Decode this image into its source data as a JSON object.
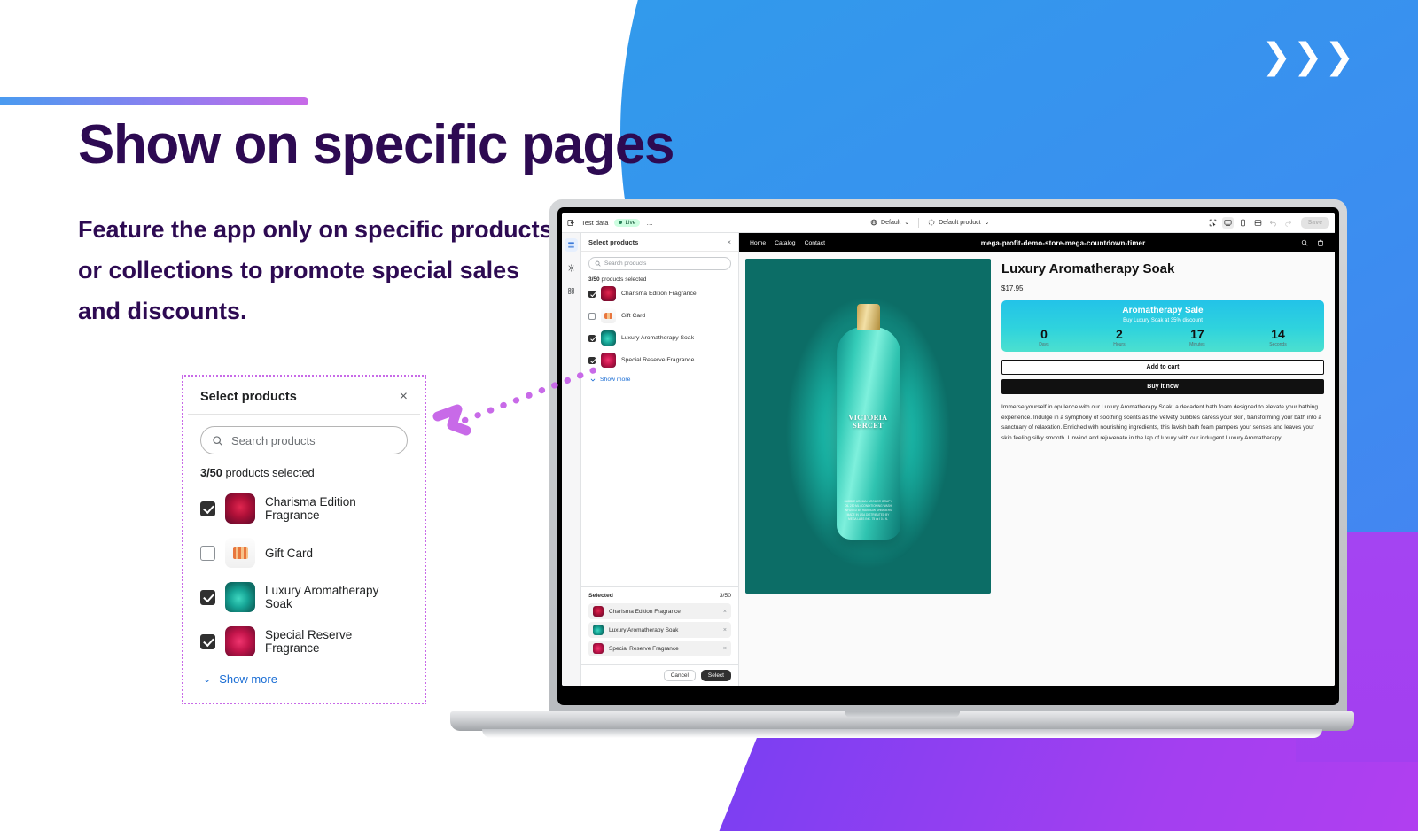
{
  "hero": {
    "headline": "Show on specific pages",
    "subhead": "Feature the app only on specific products or collections to promote special sales and discounts.",
    "chevron_glyph": "❯"
  },
  "colors": {
    "heading": "#2d0a52",
    "blue": "#3b8ef0",
    "purple": "#a33ff0",
    "callout_border": "#c86ae8",
    "link": "#1a6dd4",
    "timer_start": "#23c3e8",
    "timer_end": "#4ce0cf"
  },
  "callout": {
    "title": "Select products",
    "close_label": "×",
    "search_placeholder": "Search products",
    "search_icon": "search-icon",
    "count_bold": "3/50",
    "count_rest": " products selected",
    "show_more": "Show more",
    "chevron": "⌄",
    "products": [
      {
        "name": "Charisma Edition Fragrance",
        "checked": true,
        "thumb": "t-charisma"
      },
      {
        "name": "Gift Card",
        "checked": false,
        "thumb": "t-gift"
      },
      {
        "name": "Luxury Aromatherapy Soak",
        "checked": true,
        "thumb": "t-luxury"
      },
      {
        "name": "Special Reserve Fragrance",
        "checked": true,
        "thumb": "t-special"
      }
    ]
  },
  "admin": {
    "topbar": {
      "exit_icon": "exit-icon",
      "store_name": "Test data",
      "status": "Live",
      "more": "…",
      "theme_select": "Default",
      "template_select": "Default product",
      "theme_icon": "globe-icon",
      "template_icon": "page-icon",
      "chevron": "⌄",
      "view_icons": [
        "inspector-icon",
        "desktop-icon",
        "mobile-icon",
        "fullscreen-icon"
      ],
      "undo_icon": "undo-icon",
      "redo_icon": "redo-icon",
      "save_label": "Save"
    },
    "rail": [
      "sections-icon",
      "settings-icon",
      "apps-icon"
    ],
    "panel": {
      "title": "Select products",
      "close_label": "×",
      "search_placeholder": "Search products",
      "count_bold": "3/50",
      "count_rest": " products selected",
      "show_more": "Show more",
      "products": [
        {
          "name": "Charisma Edition Fragrance",
          "checked": true,
          "thumb": "t-charisma"
        },
        {
          "name": "Gift Card",
          "checked": false,
          "thumb": "t-gift"
        },
        {
          "name": "Luxury Aromatherapy Soak",
          "checked": true,
          "thumb": "t-luxury"
        },
        {
          "name": "Special Reserve Fragrance",
          "checked": true,
          "thumb": "t-special"
        }
      ],
      "selected_label": "Selected",
      "selected_count": "3/50",
      "selected_items": [
        {
          "name": "Charisma Edition Fragrance",
          "thumb": "t-charisma",
          "remove": "×"
        },
        {
          "name": "Luxury Aromatherapy Soak",
          "thumb": "t-luxury",
          "remove": "×"
        },
        {
          "name": "Special Reserve Fragrance",
          "thumb": "t-special",
          "remove": "×"
        }
      ],
      "cancel_label": "Cancel",
      "select_label": "Select"
    }
  },
  "store": {
    "nav_links": [
      "Home",
      "Catalog",
      "Contact"
    ],
    "brand": "mega-profit-demo-store-mega-countdown-timer",
    "search_icon": "search-icon",
    "cart_icon": "cart-icon",
    "bottle_brand": "VICTORIA SERCET",
    "bottle_fineprint": "BUBBLE AROMA / AROMATHERAPY OIL 250 ML / CONDITIONING WASH INFUSED BY RAINBOW SHIMMERS MADE IN USA DISTRIBUTED BY MEGA LABS INC.  75 oz l 0.4 fL",
    "product": {
      "title": "Luxury Aromatherapy Soak",
      "price": "$17.95",
      "add_to_cart": "Add to cart",
      "buy_now": "Buy it now",
      "description": "Immerse yourself in opulence with our Luxury Aromatherapy Soak, a decadent bath foam designed to elevate your bathing experience. Indulge in a symphony of soothing scents as the velvety bubbles caress your skin, transforming your bath into a sanctuary of relaxation. Enriched with nourishing ingredients, this lavish bath foam pampers your senses and leaves your skin feeling silky smooth. Unwind and rejuvenate in the lap of luxury with our indulgent Luxury Aromatherapy"
    },
    "timer": {
      "heading": "Aromatherapy Sale",
      "subheading": "Buy Luxury Soak at 35% discount",
      "units": [
        {
          "value": "0",
          "label": "Days"
        },
        {
          "value": "2",
          "label": "Hours"
        },
        {
          "value": "17",
          "label": "Minutes"
        },
        {
          "value": "14",
          "label": "Seconds"
        }
      ]
    }
  }
}
